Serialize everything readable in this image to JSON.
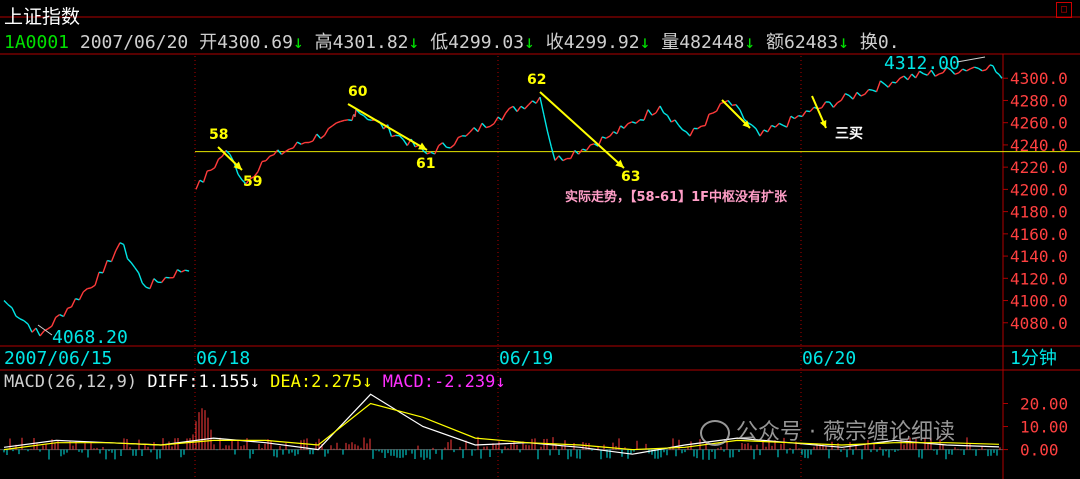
{
  "header": {
    "title": "上证指数",
    "code": "1A0001",
    "date": "2007/06/20",
    "open": "开4300.69",
    "high": "高4301.82",
    "low": "低4299.03",
    "close": "收4299.92",
    "volume": "量482448",
    "amount": "额62483",
    "turnover": "换0.",
    "arrow": "↓"
  },
  "price_labels": {
    "max_label": "4312.00",
    "min_label": "4068.20"
  },
  "time_axis": {
    "left_date": "2007/06/15",
    "dates": [
      "06/18",
      "06/19",
      "06/20"
    ],
    "period": "1分钟"
  },
  "macd": {
    "header": "MACD(26,12,9)",
    "diff": "DIFF:1.155",
    "dea": "DEA:2.275",
    "macd": "MACD:-2.239",
    "arrow": "↓",
    "ticks": [
      "20.00",
      "10.00",
      "0.00"
    ]
  },
  "annotations": {
    "points": [
      "58",
      "59",
      "60",
      "61",
      "62",
      "63"
    ],
    "note": "实际走势，【58-61】1F中枢没有扩张",
    "third_buy": "三买"
  },
  "watermark": "公众号 · 薇宗缠论细读",
  "colors": {
    "background": "#000000",
    "up": "#ff3b3b",
    "down": "#00e6e6",
    "grid": "#b00000",
    "hline": "#e6e600",
    "dea": "#ffff00",
    "diff": "#ffffff",
    "annotation": "#ffff00",
    "note": "#ff9ec7"
  },
  "chart_data": [
    {
      "type": "line",
      "title": "上证指数 1分钟",
      "xlabel": "",
      "ylabel": "",
      "x": [
        "06/15",
        "06/15",
        "06/15",
        "06/15",
        "06/15",
        "06/15",
        "06/18",
        "06/18",
        "06/18",
        "06/18",
        "06/18",
        "06/18",
        "06/18",
        "06/19",
        "06/19",
        "06/19",
        "06/19",
        "06/19",
        "06/19",
        "06/19",
        "06/20",
        "06/20",
        "06/20",
        "06/20",
        "06/20",
        "06/20",
        "06/20"
      ],
      "series": [
        {
          "values": [
            4100,
            4068.2,
            4125,
            4152,
            4112,
            4132,
            4200,
            4235,
            4205,
            4225,
            4262,
            4272,
            4232,
            4248,
            4265,
            4283,
            4226,
            4248,
            4255,
            4275,
            4248,
            4280,
            4248,
            4270,
            4300,
            4312,
            4299.92
          ]
        }
      ],
      "ylim": [
        4060,
        4320
      ],
      "yticks": [
        4080,
        4100,
        4120,
        4140,
        4160,
        4180,
        4200,
        4220,
        4240,
        4260,
        4280,
        4300
      ],
      "hline": 4234,
      "grid": true
    },
    {
      "type": "line",
      "title": "MACD(26,12,9)",
      "xlabel": "",
      "ylabel": "",
      "series": [
        {
          "name": "DIFF",
          "values": [
            1,
            4,
            3,
            2,
            5,
            3,
            0,
            24,
            10,
            2,
            3,
            1,
            -2,
            2,
            5,
            3,
            1,
            4,
            2,
            1.155
          ]
        },
        {
          "name": "DEA",
          "values": [
            0,
            3,
            3,
            2,
            4,
            4,
            2,
            20,
            14,
            5,
            3,
            2,
            0,
            1,
            4,
            3,
            2,
            3,
            3,
            2.275
          ]
        }
      ],
      "ylim": [
        -8,
        25
      ],
      "yticks": [
        0,
        10,
        20
      ],
      "grid": true
    }
  ]
}
